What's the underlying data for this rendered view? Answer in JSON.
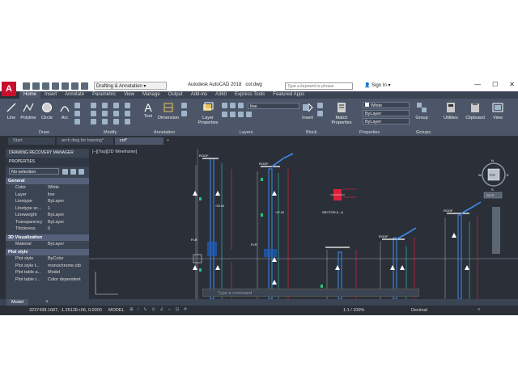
{
  "title_bar": {
    "logo_letter": "A",
    "workspace": "Drafting & Annotation",
    "app_title": "Autodesk AutoCAD 2018",
    "file_name": "col.dwg",
    "search_placeholder": "Type a keyword or phrase",
    "sign_in": "Sign In",
    "min": "—",
    "max": "☐",
    "close": "✕"
  },
  "ribbon_tabs": [
    "Home",
    "Insert",
    "Annotate",
    "Parametric",
    "View",
    "Manage",
    "Output",
    "Add-ins",
    "A360",
    "Express Tools",
    "Featured Apps"
  ],
  "ribbon": {
    "draw": {
      "line": "Line",
      "polyline": "Polyline",
      "circle": "Circle",
      "arc": "Arc",
      "title": "Draw"
    },
    "modify": {
      "title": "Modify"
    },
    "annotation": {
      "text": "Text",
      "dimension": "Dimension",
      "title": "Annotation"
    },
    "layers": {
      "layer_properties": "Layer Properties",
      "title": "Layers",
      "current_layer": "line"
    },
    "block": {
      "insert": "Insert",
      "title": "Block"
    },
    "properties": {
      "match": "Match Properties",
      "color": "White",
      "linetype": "ByLayer",
      "lineweight": "ByLayer",
      "title": "Properties"
    },
    "groups": {
      "group": "Group",
      "title": "Groups"
    },
    "utilities": "Utilities",
    "clipboard": "Clipboard",
    "view": "View"
  },
  "file_tabs": {
    "start": "Start",
    "tab1": "arch dwg for training*",
    "tab2": "col*"
  },
  "palette": {
    "recovery": "DRAWING RECOVERY MANAGER",
    "properties": "PROPERTIES",
    "selection": "No selection",
    "general_title": "General",
    "general": [
      {
        "k": "Color",
        "v": "White"
      },
      {
        "k": "Layer",
        "v": "line"
      },
      {
        "k": "Linetype",
        "v": "ByLayer"
      },
      {
        "k": "Linetype sc...",
        "v": "1"
      },
      {
        "k": "Lineweight",
        "v": "ByLayer"
      },
      {
        "k": "Transparency",
        "v": "ByLayer"
      },
      {
        "k": "Thickness",
        "v": "0"
      }
    ],
    "viz_title": "3D Visualization",
    "viz": [
      {
        "k": "Material",
        "v": "ByLayer"
      }
    ],
    "plot_title": "Plot style",
    "plot": [
      {
        "k": "Plot style",
        "v": "ByColor"
      },
      {
        "k": "Plot style t...",
        "v": "monochrome.ctb"
      },
      {
        "k": "Plot table a...",
        "v": "Model"
      },
      {
        "k": "Plot table t...",
        "v": "Color dependent"
      }
    ]
  },
  "canvas": {
    "view_label": "[–][Top][2D Wireframe]",
    "compass": {
      "n": "N",
      "s": "S",
      "e": "E",
      "w": "W",
      "top": "TOP",
      "wcs": "WCS"
    },
    "labels": {
      "roof1": "ROOF",
      "roof2": "ROOF",
      "roof3": "ROOF",
      "roof4": "ROOF",
      "ceiling1": "FLR",
      "ceiling2": "FLR",
      "sector": "SECTOR A - A",
      "level_a": "+20.04",
      "level_b": "+17.00"
    }
  },
  "command": {
    "placeholder": "Type a command"
  },
  "layout_tabs": {
    "model": "Model"
  },
  "status": {
    "coords": "3237438.1687, -1.2512E+06, 0.0000",
    "model": "MODEL",
    "scale": "1:1 / 100%",
    "units": "Decimal"
  }
}
